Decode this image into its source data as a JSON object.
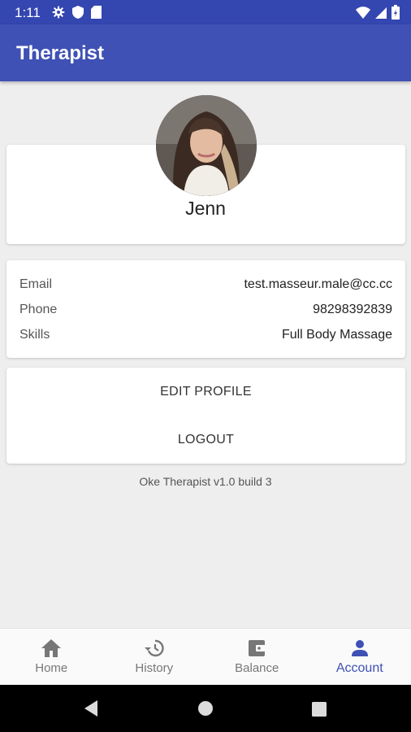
{
  "status_bar": {
    "time": "1:11"
  },
  "app_bar": {
    "title": "Therapist"
  },
  "profile": {
    "name": "Jenn"
  },
  "info": {
    "rows": [
      {
        "label": "Email",
        "value": "test.masseur.male@cc.cc"
      },
      {
        "label": "Phone",
        "value": "98298392839"
      },
      {
        "label": "Skills",
        "value": "Full Body Massage"
      }
    ]
  },
  "actions": {
    "edit_profile": "EDIT PROFILE",
    "logout": "LOGOUT"
  },
  "version": "Oke Therapist v1.0 build 3",
  "bottom_nav": {
    "items": [
      {
        "label": "Home",
        "icon": "home-icon"
      },
      {
        "label": "History",
        "icon": "history-icon"
      },
      {
        "label": "Balance",
        "icon": "wallet-icon"
      },
      {
        "label": "Account",
        "icon": "person-icon"
      }
    ],
    "active": "Account"
  },
  "colors": {
    "primary": "#3f51b5",
    "status_bar": "#3446b0",
    "background": "#eeeeee"
  }
}
